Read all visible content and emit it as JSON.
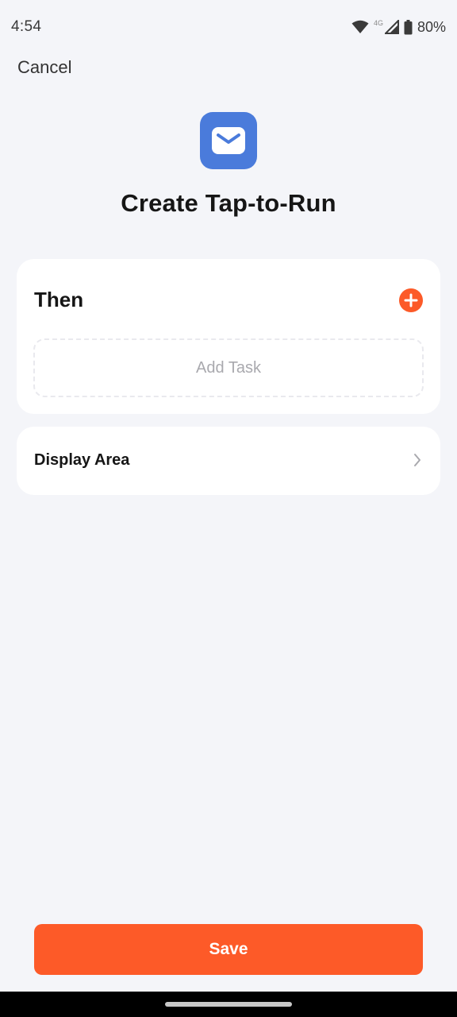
{
  "status_bar": {
    "time": "4:54",
    "network": "4G",
    "battery": "80%"
  },
  "header": {
    "cancel_label": "Cancel",
    "title": "Create Tap-to-Run",
    "icon": "mail-icon"
  },
  "then_section": {
    "title": "Then",
    "add_icon": "plus-circle-icon",
    "add_task_label": "Add Task"
  },
  "display_area": {
    "label": "Display Area",
    "icon": "chevron-right-icon"
  },
  "footer": {
    "save_label": "Save"
  },
  "colors": {
    "accent": "#fd5a28",
    "app_icon_bg": "#4a7bdb",
    "background": "#f4f5f9"
  }
}
